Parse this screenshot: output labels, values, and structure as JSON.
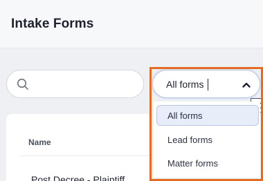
{
  "header": {
    "title": "Intake Forms"
  },
  "search": {
    "value": "",
    "placeholder": ""
  },
  "filter": {
    "selected": "All forms",
    "options": [
      "All forms",
      "Lead forms",
      "Matter forms"
    ]
  },
  "tooltip": {
    "text": "C"
  },
  "table": {
    "columns": [
      "Name"
    ],
    "rows": [
      {
        "name": "Post Decree - Plaintiff"
      }
    ]
  },
  "colors": {
    "highlight_border": "#e36b22",
    "selected_option_bg": "#e7edf9",
    "header_bg": "#f7f8fa",
    "page_bg": "#eef0f3"
  },
  "icons": {
    "search": "search-icon",
    "chevron": "chevron-up-icon"
  }
}
